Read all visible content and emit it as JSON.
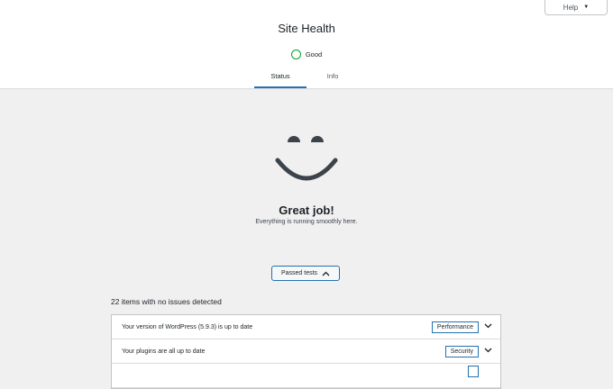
{
  "header": {
    "help_label": "Help",
    "title": "Site Health",
    "status": "Good",
    "tabs": [
      {
        "label": "Status",
        "active": true
      },
      {
        "label": "Info",
        "active": false
      }
    ]
  },
  "main": {
    "heading": "Great job!",
    "subheading": "Everything is running smoothly here.",
    "passed_button": "Passed tests",
    "count_text": "22 items with no issues detected",
    "items": [
      {
        "title": "Your version of WordPress (5.9.3) is up to date",
        "badge": "Performance"
      },
      {
        "title": "Your plugins are all up to date",
        "badge": "Security"
      },
      {
        "title": "",
        "badge": ""
      }
    ]
  },
  "colors": {
    "accent": "#2271b1",
    "good": "#00a32a",
    "background": "#f0f0f1"
  }
}
